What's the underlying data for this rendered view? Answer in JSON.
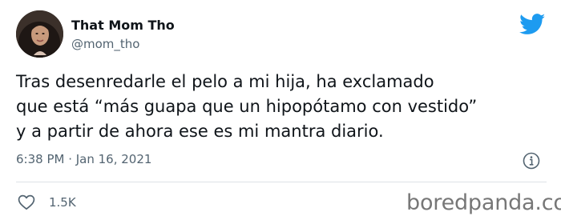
{
  "author": {
    "name": "That Mom Tho",
    "handle": "@mom_tho"
  },
  "tweet": {
    "lines": [
      "Tras desenredarle el pelo a mi hija, ha exclamado",
      "que está “más guapa que un hipopótamo con vestido”",
      "y a partir de ahora ese es mi mantra diario."
    ],
    "timestamp": "6:38 PM · Jan 16, 2021"
  },
  "engagement": {
    "likes": "1.5K"
  },
  "watermark": "boredpanda.com",
  "icons": {
    "logo": "twitter-bird-icon",
    "info": "info-icon",
    "like": "heart-icon"
  },
  "colors": {
    "brand": "#1d9bf0",
    "text": "#0f1419",
    "secondary": "#536471"
  }
}
